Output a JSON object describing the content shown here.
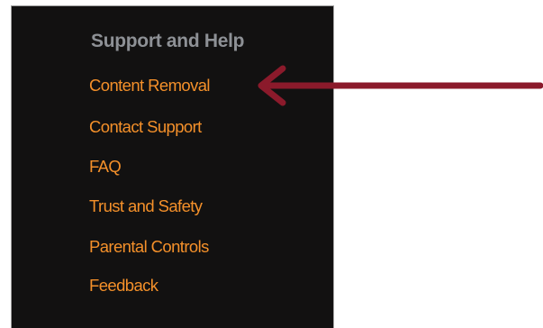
{
  "panel": {
    "heading": "Support and Help",
    "links": [
      "Content Removal",
      "Contact Support",
      "FAQ",
      "Trust and Safety",
      "Parental Controls",
      "Feedback"
    ]
  },
  "colors": {
    "panel_background": "#121111",
    "heading": "#8e9196",
    "link": "#f4902a",
    "arrow": "#8b1a2b"
  },
  "annotation": {
    "icon": "arrow-left-icon",
    "points_to": "Content Removal"
  }
}
